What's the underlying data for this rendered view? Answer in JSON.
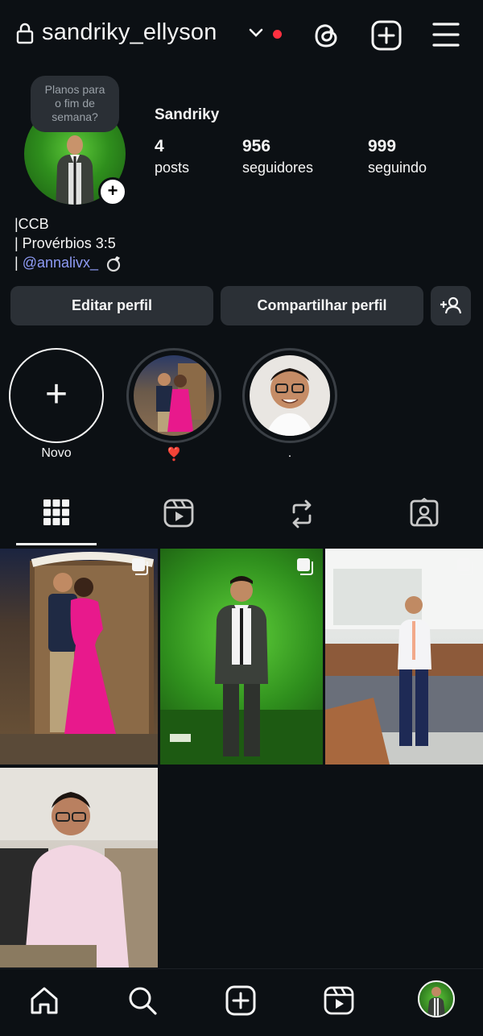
{
  "header": {
    "username": "sandriky_ellyson",
    "icons": [
      "lock-icon",
      "chevron-down-icon",
      "threads-icon",
      "create-icon",
      "menu-icon"
    ]
  },
  "profile": {
    "note": [
      "Planos para",
      "o fim de",
      "semana?"
    ],
    "display_name": "Sandriky",
    "stats": [
      {
        "num": "4",
        "label": "posts"
      },
      {
        "num": "956",
        "label": "seguidores"
      },
      {
        "num": "999",
        "label": "seguindo"
      }
    ],
    "bio": {
      "line1": "|CCB",
      "line2": "| Provérbios 3:5",
      "line3_prefix": "| ",
      "mention": "@annalivx_"
    }
  },
  "buttons": {
    "edit": "Editar perfil",
    "share": "Compartilhar perfil",
    "add_person_icon": "add-person-icon"
  },
  "highlights": [
    {
      "label": "Novo"
    },
    {
      "label": "❣️"
    },
    {
      "label": "."
    }
  ],
  "tabs": [
    "grid-icon",
    "reels-icon",
    "reposts-icon",
    "tagged-icon"
  ],
  "bottom_nav": [
    "home-icon",
    "search-icon",
    "create-icon",
    "reels-icon",
    "profile-avatar"
  ],
  "colors": {
    "background": "#0c1014",
    "button": "#2b3036",
    "mention": "#8e9bf5",
    "notification": "#ff3040"
  }
}
